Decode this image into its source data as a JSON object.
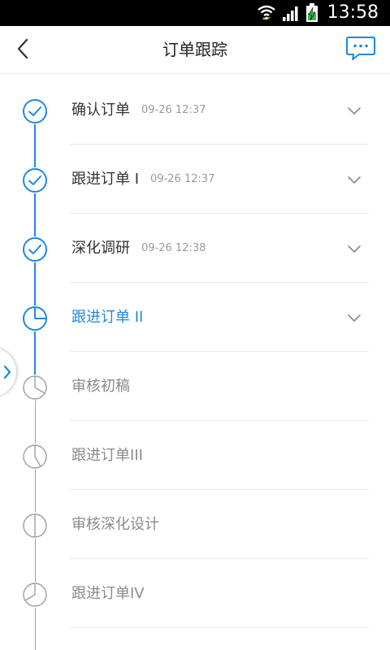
{
  "status_bar": {
    "time": "13:58",
    "icons": [
      "wifi-icon",
      "signal-icon",
      "battery-charging-icon"
    ]
  },
  "header": {
    "back_icon": "chevron-left-icon",
    "title": "订单跟踪",
    "message_icon": "chat-bubble-icon"
  },
  "colors": {
    "accent": "#1e88e5",
    "done_line": "#1e88e5",
    "pending": "#9e9e9e",
    "text_done": "#333333",
    "text_current": "#1e88e5",
    "text_pending": "#8a8a8a"
  },
  "steps": [
    {
      "label": "确认订单",
      "time": "09-26 12:37",
      "state": "done",
      "icon": "check-circle-icon",
      "expandable": true
    },
    {
      "label": "跟进订单 I",
      "time": "09-26 12:37",
      "state": "done",
      "icon": "check-circle-icon",
      "expandable": true
    },
    {
      "label": "深化调研",
      "time": "09-26 12:38",
      "state": "done",
      "icon": "check-circle-icon",
      "expandable": true
    },
    {
      "label": "跟进订单 II",
      "time": "",
      "state": "current",
      "icon": "clock-icon",
      "expandable": true
    },
    {
      "label": "审核初稿",
      "time": "",
      "state": "pending",
      "icon": "clock-icon",
      "expandable": false
    },
    {
      "label": "跟进订单III",
      "time": "",
      "state": "pending",
      "icon": "clock-icon",
      "expandable": false
    },
    {
      "label": "审核深化设计",
      "time": "",
      "state": "pending",
      "icon": "clock-icon",
      "expandable": false
    },
    {
      "label": "跟进订单IV",
      "time": "",
      "state": "pending",
      "icon": "clock-icon",
      "expandable": false
    }
  ],
  "side_tab": {
    "icon": "chevron-right-icon"
  }
}
